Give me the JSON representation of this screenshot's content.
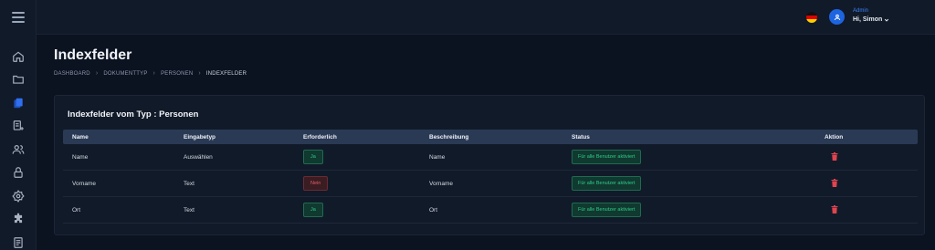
{
  "topbar": {
    "role": "Admin",
    "greeting": "Hi, Simon",
    "icons": {
      "menu": "hamburger-icon",
      "language": "german-flag-icon",
      "user": "user-icon",
      "dropdown": "chevron-down-icon"
    }
  },
  "sidebar": {
    "items": [
      {
        "icon": "home-icon"
      },
      {
        "icon": "folder-icon"
      },
      {
        "icon": "documents-icon",
        "active": true
      },
      {
        "icon": "document-add-icon"
      },
      {
        "icon": "users-icon"
      },
      {
        "icon": "lock-icon"
      },
      {
        "icon": "settings-icon"
      },
      {
        "icon": "puzzle-icon"
      },
      {
        "icon": "list-document-icon"
      }
    ]
  },
  "page": {
    "title": "Indexfelder",
    "breadcrumb": [
      "DASHBOARD",
      "DOKUMENTTYP",
      "PERSONEN",
      "INDEXFELDER"
    ]
  },
  "card": {
    "title": "Indexfelder vom Typ : Personen",
    "columns": [
      "Name",
      "Eingabetyp",
      "Erforderlich",
      "Beschreibung",
      "Status",
      "Aktion"
    ],
    "rows": [
      {
        "name": "Name",
        "type": "Auswählen",
        "required": "Ja",
        "description": "Name",
        "status": "Für alle Benutzer aktiviert"
      },
      {
        "name": "Vorname",
        "type": "Text",
        "required": "Nein",
        "description": "Vorname",
        "status": "Für alle Benutzer aktiviert"
      },
      {
        "name": "Ort",
        "type": "Text",
        "required": "Ja",
        "description": "Ort",
        "status": "Für alle Benutzer aktiviert"
      }
    ]
  },
  "colors": {
    "accent": "#1d64e0",
    "success": "#2ecc8a",
    "danger": "#e35d6a",
    "background": "#0b1220",
    "panel": "#111a29"
  }
}
